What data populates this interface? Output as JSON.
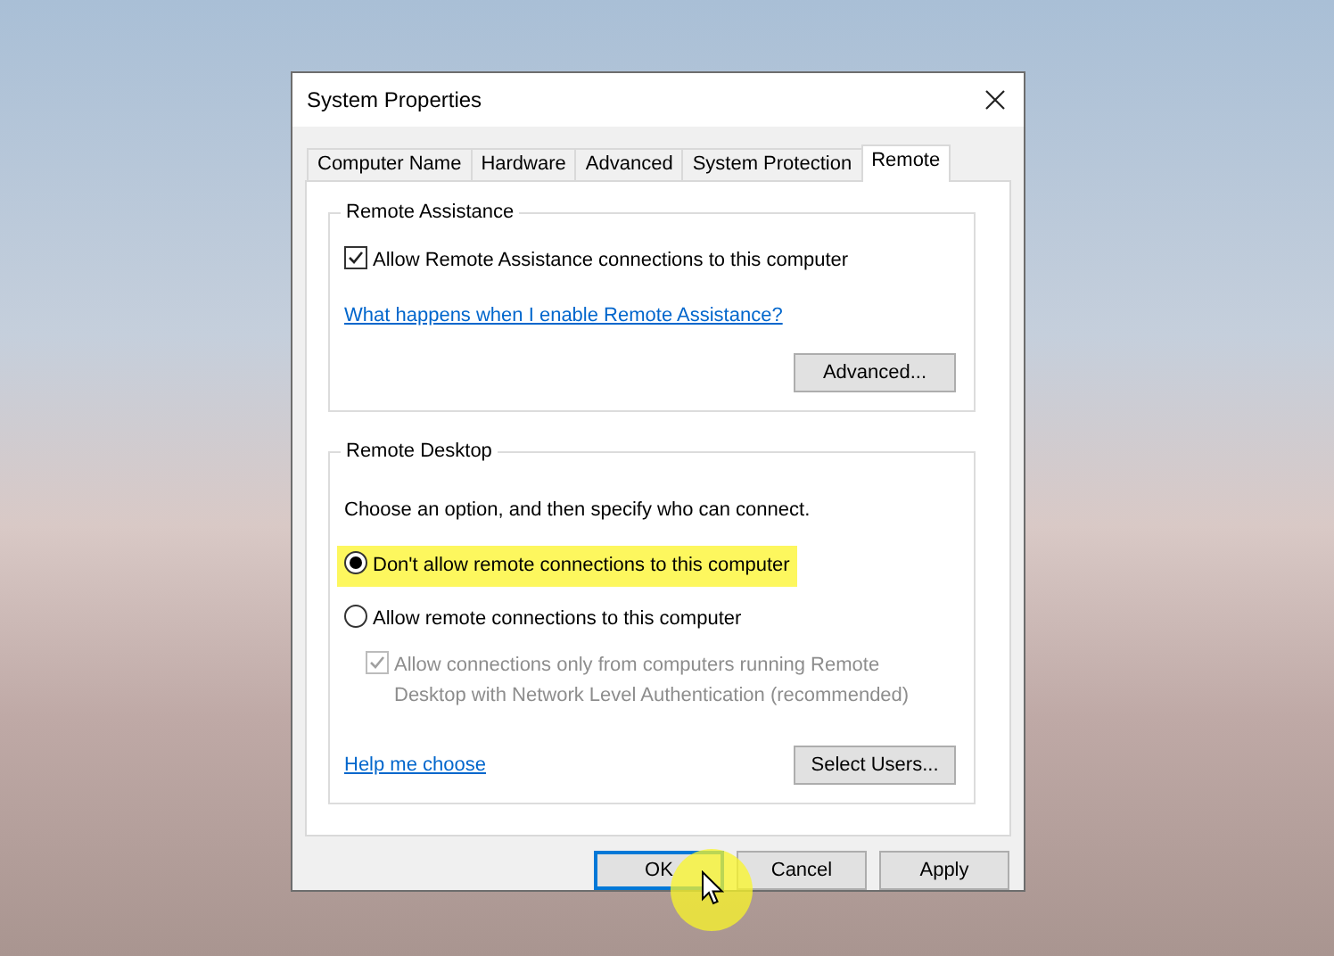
{
  "window": {
    "title": "System Properties"
  },
  "tabs": [
    {
      "label": "Computer Name",
      "selected": false
    },
    {
      "label": "Hardware",
      "selected": false
    },
    {
      "label": "Advanced",
      "selected": false
    },
    {
      "label": "System Protection",
      "selected": false
    },
    {
      "label": "Remote",
      "selected": true
    }
  ],
  "remote_assistance": {
    "title": "Remote Assistance",
    "allow_checkbox": {
      "label": "Allow Remote Assistance connections to this computer",
      "checked": true
    },
    "link": "What happens when I enable Remote Assistance?",
    "advanced_button": "Advanced..."
  },
  "remote_desktop": {
    "title": "Remote Desktop",
    "instruction": "Choose an option, and then specify who can connect.",
    "options": [
      {
        "label": "Don't allow remote connections to this computer",
        "selected": true,
        "highlighted": true
      },
      {
        "label": "Allow remote connections to this computer",
        "selected": false,
        "highlighted": false
      }
    ],
    "nla_checkbox": {
      "label": "Allow connections only from computers running Remote Desktop with Network Level Authentication (recommended)",
      "checked": true,
      "disabled": true
    },
    "help_link": "Help me choose",
    "select_users_button": "Select Users..."
  },
  "buttons": [
    {
      "label": "OK",
      "default": true
    },
    {
      "label": "Cancel",
      "default": false
    },
    {
      "label": "Apply",
      "default": false
    }
  ]
}
